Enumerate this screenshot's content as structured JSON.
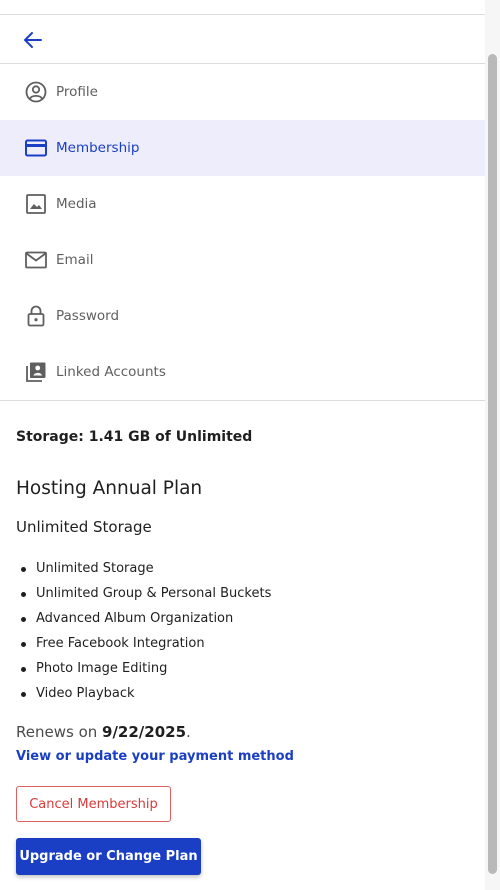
{
  "header": {
    "back_label": "Back"
  },
  "nav": {
    "items": [
      {
        "label": "Profile",
        "icon": "profile-icon",
        "active": false
      },
      {
        "label": "Membership",
        "icon": "credit-card-icon",
        "active": true
      },
      {
        "label": "Media",
        "icon": "image-icon",
        "active": false
      },
      {
        "label": "Email",
        "icon": "mail-icon",
        "active": false
      },
      {
        "label": "Password",
        "icon": "lock-icon",
        "active": false
      },
      {
        "label": "Linked Accounts",
        "icon": "linked-accounts-icon",
        "active": false
      }
    ]
  },
  "membership": {
    "storage": "Storage: 1.41 GB of Unlimited",
    "plan_title": "Hosting Annual Plan",
    "plan_subtitle": "Unlimited Storage",
    "features": [
      "Unlimited Storage",
      "Unlimited Group & Personal Buckets",
      "Advanced Album Organization",
      "Free Facebook Integration",
      "Photo Image Editing",
      "Video Playback"
    ],
    "renews_prefix": "Renews on ",
    "renews_date": "9/22/2025",
    "renews_suffix": ".",
    "payment_link": "View or update your payment method",
    "cancel_button": "Cancel Membership",
    "upgrade_button": "Upgrade or Change Plan"
  },
  "colors": {
    "accent": "#1b3fc4",
    "active_bg": "#ededfb",
    "danger": "#d93a3a"
  }
}
